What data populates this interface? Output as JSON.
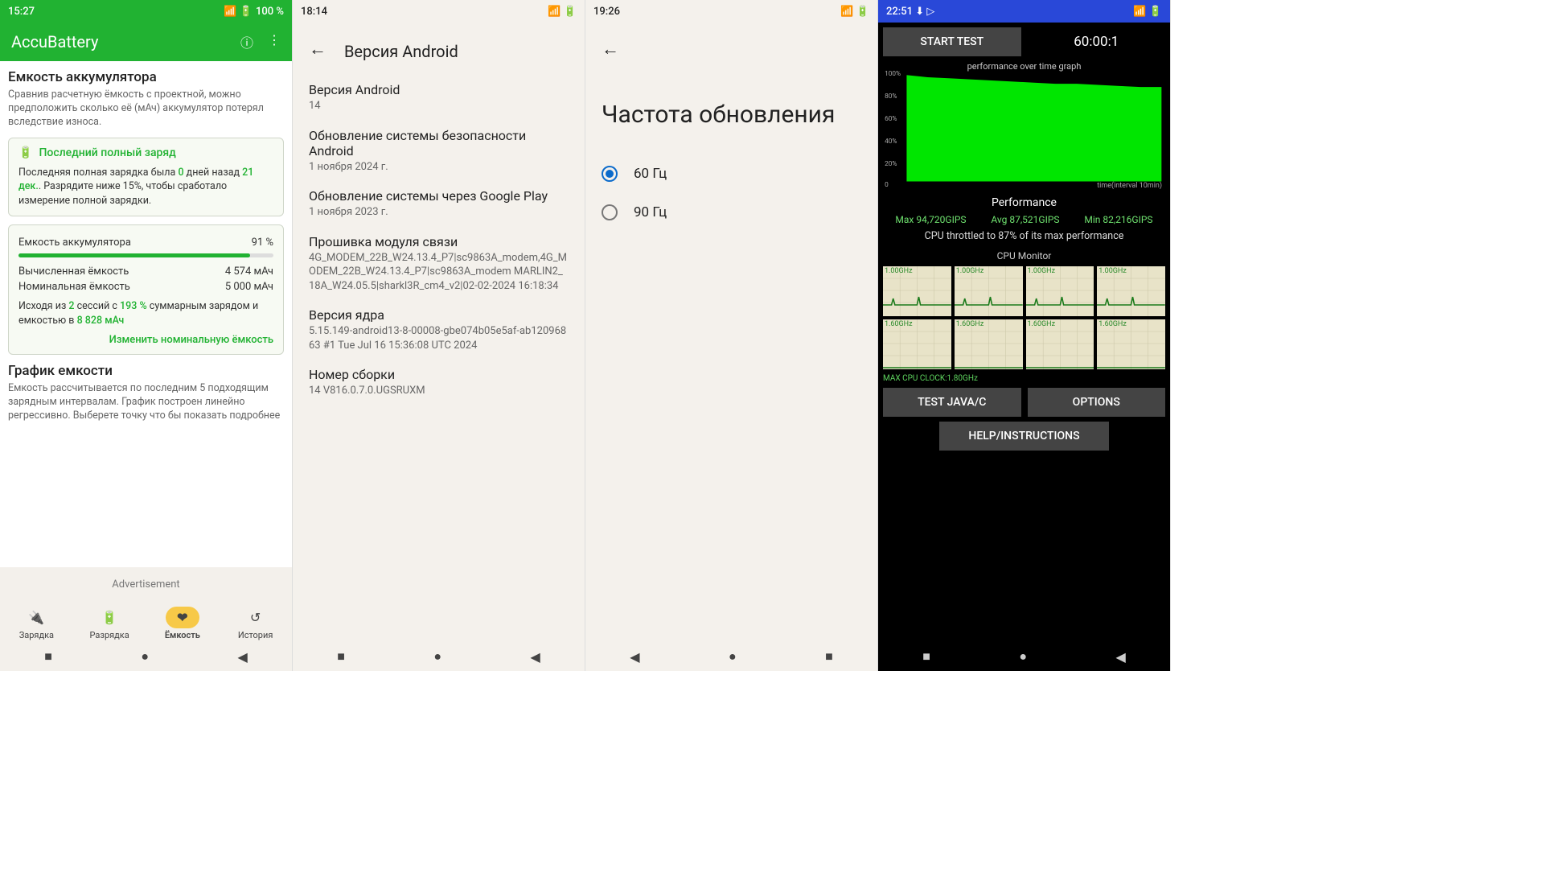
{
  "p1": {
    "status": {
      "time": "15:27",
      "battery": "100 %"
    },
    "app_title": "AccuBattery",
    "section1": {
      "title": "Емкость аккумулятора",
      "desc": "Сравнив расчетную ёмкость с проектной, можно предположить сколько её (мАч) аккумулятор потерял вследствие износа."
    },
    "card1": {
      "chip": "Последний полный заряд",
      "text_a": "Последняя полная зарядка была ",
      "days": "0",
      "text_b": " дней назад ",
      "date": "21 дек.",
      "text_c": ". Разрядите ниже 15%, чтобы сработало измерение полной зарядки."
    },
    "card2": {
      "row1_l": "Емкость аккумулятора",
      "row1_r": "91 %",
      "row2_l": "Вычисленная ёмкость",
      "row2_r": "4 574 мАч",
      "row3_l": "Номинальная ёмкость",
      "row3_r": "5 000 мАч",
      "foot_a": "Исходя из ",
      "sess": "2",
      "foot_b": " сессий с ",
      "pct": "193 %",
      "foot_c": " суммарным зарядом и емкостью в ",
      "cap": "8 828 мАч",
      "link": "Изменить номинальную ёмкость"
    },
    "section2": {
      "title": "График емкости",
      "desc": "Емкость рассчитывается по последним 5 подходящим зарядным интервалам.  График построен линейно регрессивно. Выберете точку что бы показать подробнее"
    },
    "ad": "Advertisement",
    "nav": [
      "Зарядка",
      "Разрядка",
      "Ёмкость",
      "История"
    ]
  },
  "p2": {
    "status": {
      "time": "18:14"
    },
    "title": "Версия Android",
    "items": [
      {
        "lbl": "Версия Android",
        "val": "14"
      },
      {
        "lbl": "Обновление системы безопасности Android",
        "val": "1 ноября 2024 г."
      },
      {
        "lbl": "Обновление системы через Google Play",
        "val": "1 ноября 2023 г."
      },
      {
        "lbl": "Прошивка модуля связи",
        "val": "4G_MODEM_22B_W24.13.4_P7|sc9863A_modem,4G_MODEM_22B_W24.13.4_P7|sc9863A_modem MARLIN2_18A_W24.05.5|sharkl3R_cm4_v2|02-02-2024 16:18:34"
      },
      {
        "lbl": "Версия ядра",
        "val": "5.15.149-android13-8-00008-gbe074b05e5af-ab12096863\n#1 Tue Jul 16 15:36:08 UTC 2024"
      },
      {
        "lbl": "Номер сборки",
        "val": "14 V816.0.7.0.UGSRUXM"
      }
    ]
  },
  "p3": {
    "status": {
      "time": "19:26"
    },
    "title": "Частота обновления",
    "options": [
      "60 Гц",
      "90 Гц"
    ]
  },
  "p4": {
    "status": {
      "time": "22:51"
    },
    "start": "START TEST",
    "timer": "60:00:1",
    "graph_title": "performance over time graph",
    "graph_xlabel": "time(interval 10min)",
    "perf_label": "Performance",
    "metrics": {
      "max": "Max 94,720GIPS",
      "avg": "Avg 87,521GIPS",
      "min": "Min 82,216GIPS"
    },
    "throttle": "CPU throttled to 87% of its max performance",
    "monitor": "CPU Monitor",
    "cpu_hz": [
      "1.00GHz",
      "1.00GHz",
      "1.00GHz",
      "1.00GHz",
      "1.60GHz",
      "1.60GHz",
      "1.60GHz",
      "1.60GHz"
    ],
    "maxclk": "MAX CPU CLOCK:1.80GHz",
    "btn_java": "TEST JAVA/C",
    "btn_opts": "OPTIONS",
    "btn_help": "HELP/INSTRUCTIONS"
  },
  "chart_data": {
    "type": "area",
    "title": "performance over time graph",
    "ylabel": "%",
    "ylim": [
      0,
      100
    ],
    "xlabel": "time(interval 10min)",
    "x": [
      0,
      5,
      10,
      15,
      20,
      25,
      30,
      35,
      40,
      45,
      50,
      55,
      60
    ],
    "values": [
      98,
      96,
      95,
      94,
      93,
      92,
      91,
      90,
      90,
      89,
      88,
      87,
      87
    ]
  }
}
